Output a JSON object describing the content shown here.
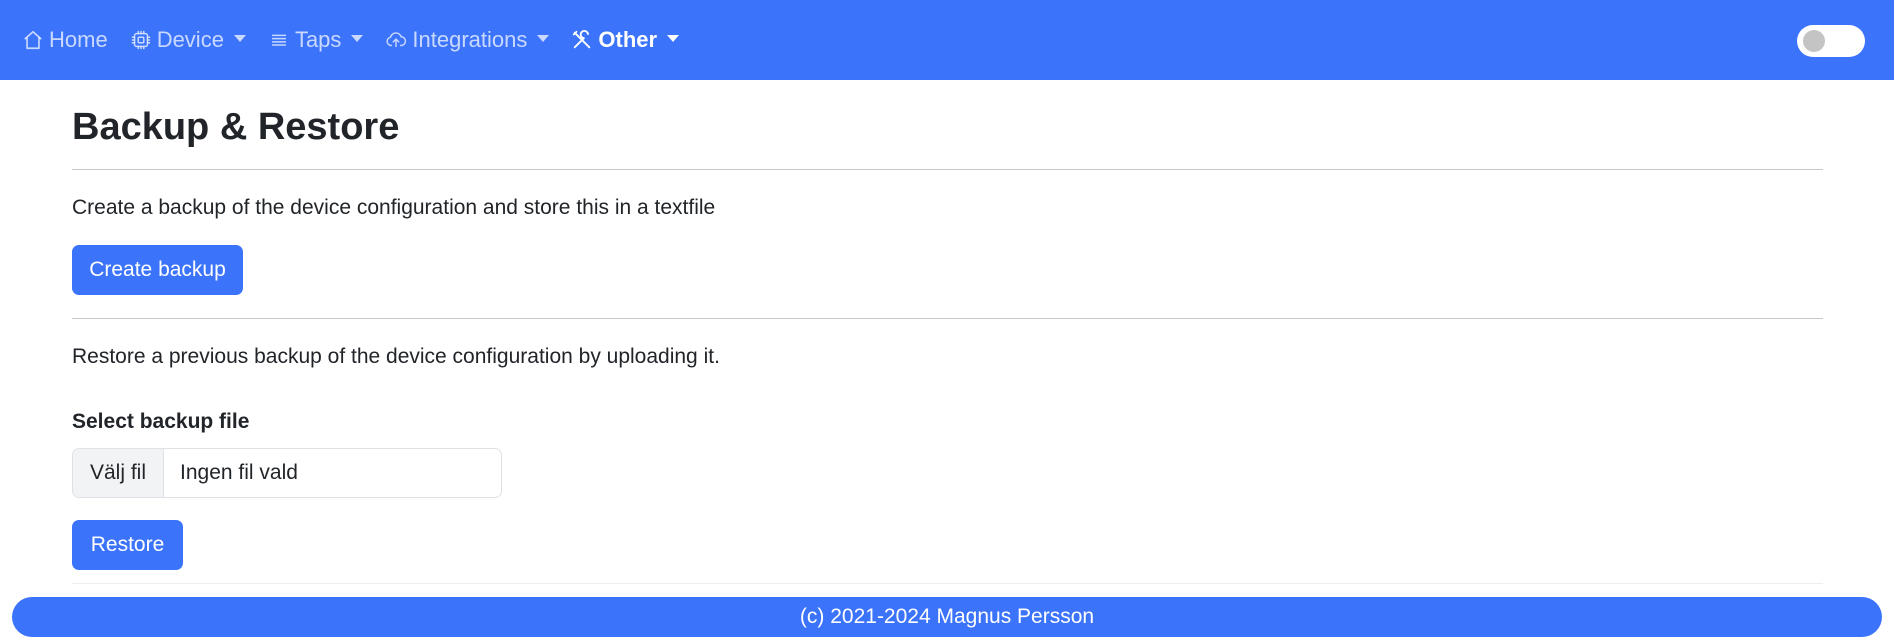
{
  "navbar": {
    "items": [
      {
        "label": "Home",
        "icon": "house-icon",
        "dropdown": false,
        "active": false
      },
      {
        "label": "Device",
        "icon": "cpu-icon",
        "dropdown": true,
        "active": false
      },
      {
        "label": "Taps",
        "icon": "list-icon",
        "dropdown": true,
        "active": false
      },
      {
        "label": "Integrations",
        "icon": "cloud-upload-icon",
        "dropdown": true,
        "active": false
      },
      {
        "label": "Other",
        "icon": "tools-icon",
        "dropdown": true,
        "active": true
      }
    ],
    "theme_toggle": {
      "state": "off"
    }
  },
  "page": {
    "title": "Backup & Restore",
    "backup_description": "Create a backup of the device configuration and store this in a textfile",
    "create_backup_label": "Create backup",
    "restore_description": "Restore a previous backup of the device configuration by uploading it.",
    "select_file_label": "Select backup file",
    "file_input": {
      "button_label": "Välj fil",
      "status_text": "Ingen fil vald"
    },
    "restore_label": "Restore"
  },
  "footer": {
    "text": "(c) 2021-2024 Magnus Persson"
  },
  "colors": {
    "primary": "#3b73fb",
    "background": "#ffffff",
    "text": "#212529"
  }
}
